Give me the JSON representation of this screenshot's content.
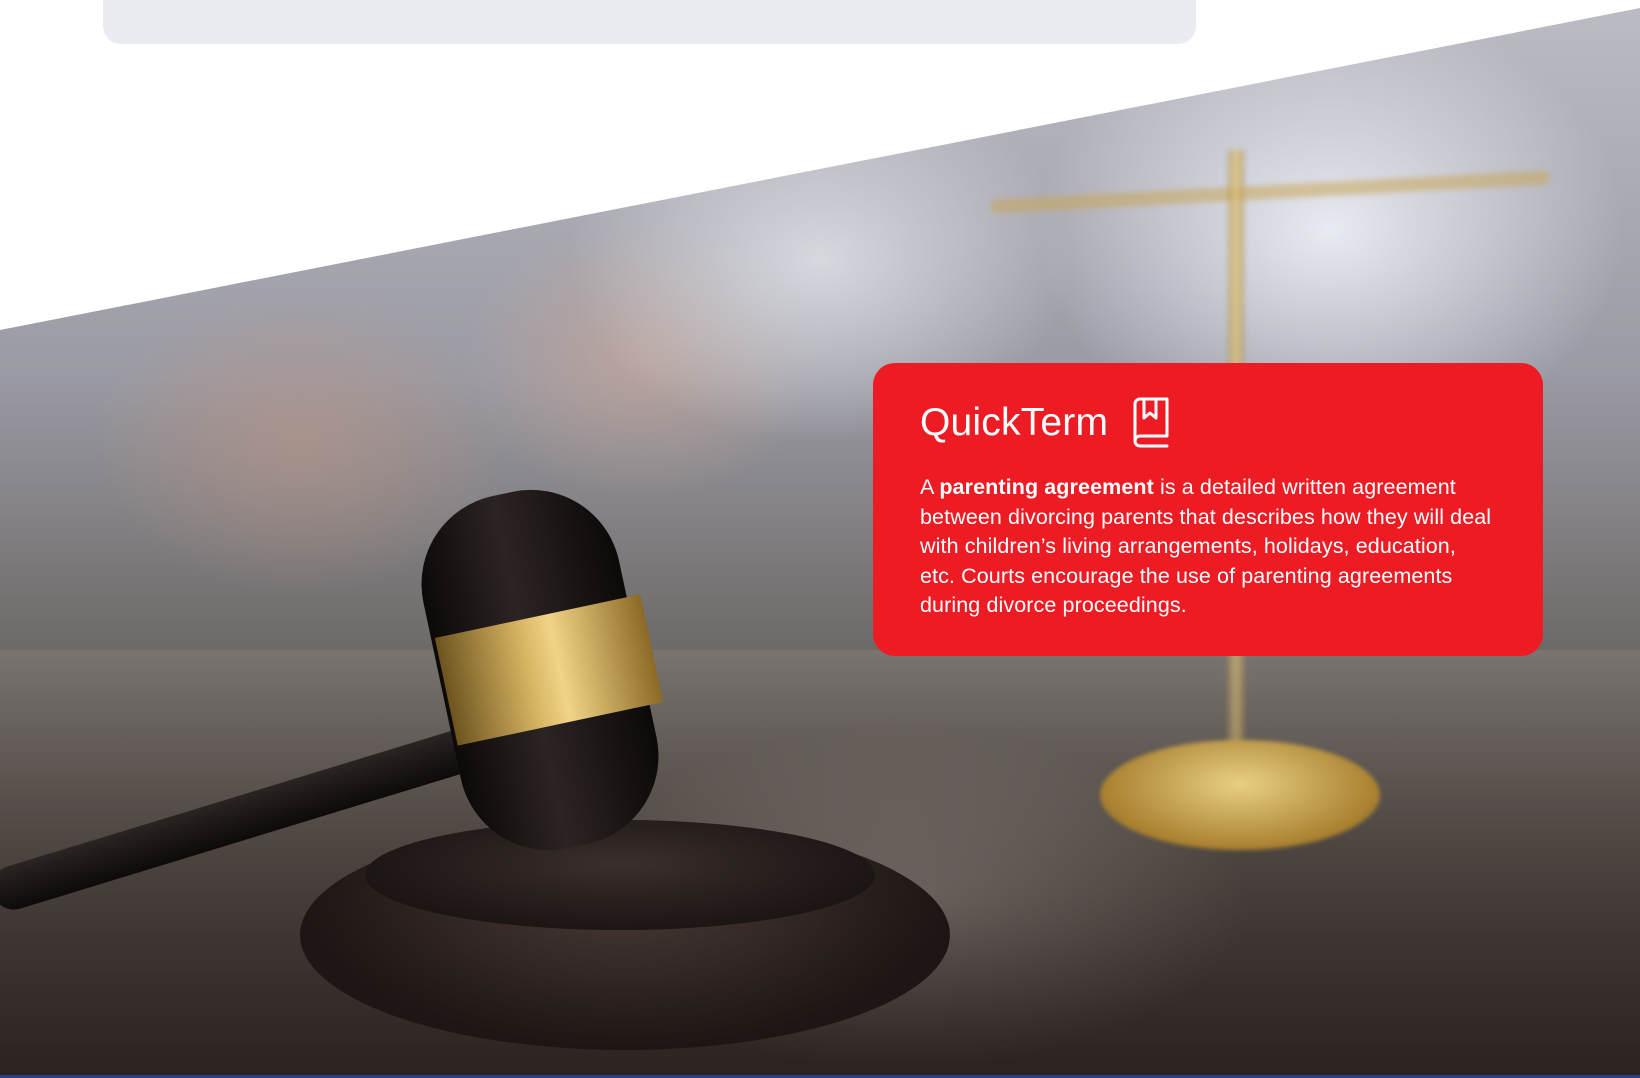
{
  "quickterm": {
    "title": "QuickTerm",
    "icon": "book-bookmark-icon",
    "body_prefix": "A ",
    "term": "parenting agreement",
    "body_rest": " is a detailed written agreement between divorcing parents that describes how they will deal with children’s living arrangements, holidays, education, etc. Courts encourage the use of parenting agreements during divorce proceedings.",
    "background_color": "#ed1c24",
    "text_color": "#ffffff"
  },
  "hero_image": {
    "subject": "gavel-and-scales-photo"
  },
  "colors": {
    "top_panel": "#e9edf1",
    "bottom_strip": "#2b3f8a"
  }
}
